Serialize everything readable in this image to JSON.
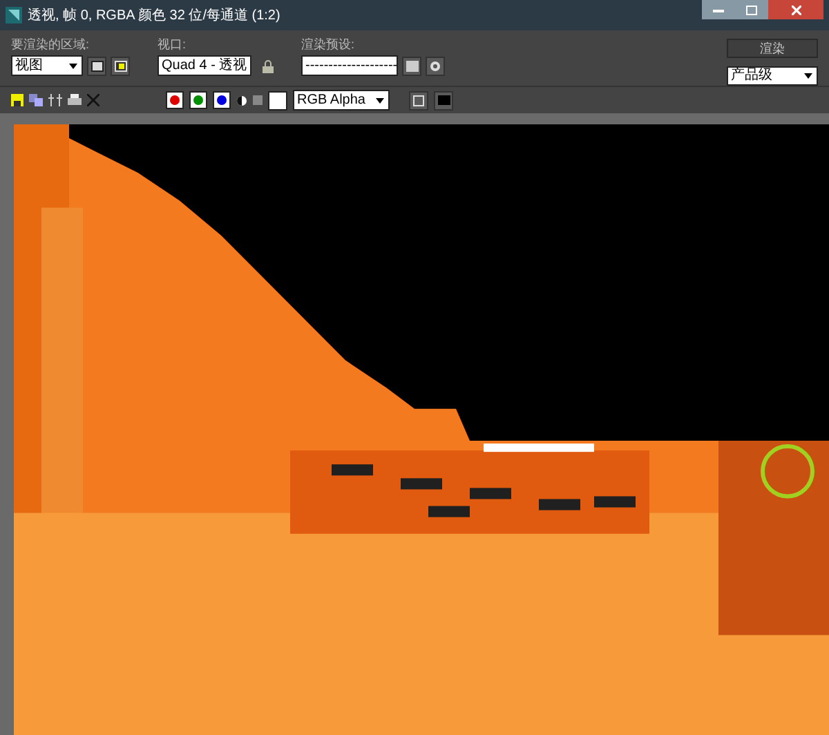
{
  "window": {
    "title": "透视, 帧 0, RGBA 颜色 32 位/每通道 (1:2)"
  },
  "area": {
    "label": "要渲染的区域:",
    "value": "视图"
  },
  "viewport": {
    "label": "视口:",
    "value": "Quad 4 - 透视"
  },
  "preset": {
    "label": "渲染预设:",
    "value": "--------------------"
  },
  "render_button": "渲染",
  "quality": {
    "value": "产品级"
  },
  "channels": [
    {
      "color": "#e00000",
      "on": true
    },
    {
      "color": "#009000",
      "on": true
    },
    {
      "color": "#0000e0",
      "on": true
    }
  ],
  "display_channel": {
    "value": "RGB Alpha"
  }
}
